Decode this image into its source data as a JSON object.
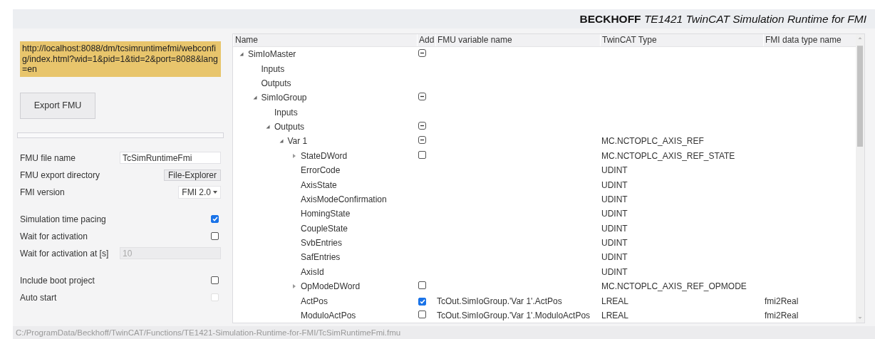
{
  "header": {
    "brand": "BECKHOFF",
    "title": "TE1421 TwinCAT Simulation Runtime for FMI"
  },
  "settings": {
    "url": "http://localhost:8088/dm/tcsimruntimefmi/webconfig/index.html?wid=1&pid=1&tid=2&port=8088&lang=en",
    "export_button": "Export FMU",
    "progress": {
      "level": 0
    },
    "groups": [
      {
        "items": [
          {
            "kind": "text",
            "label": "FMU file name",
            "value": "TcSimRuntimeFmi"
          },
          {
            "kind": "button",
            "label": "FMU export directory",
            "button": "File-Explorer"
          },
          {
            "kind": "select",
            "label": "FMI version",
            "value": "FMI 2.0"
          }
        ]
      },
      {
        "items": [
          {
            "kind": "checkbox",
            "label": "Simulation time pacing",
            "checked": true,
            "disabled": false
          },
          {
            "kind": "checkbox",
            "label": "Wait for activation",
            "checked": false,
            "disabled": false
          },
          {
            "kind": "text",
            "label": "Wait for activation at [s]",
            "value": "10",
            "disabled": true
          }
        ]
      },
      {
        "items": [
          {
            "kind": "checkbox",
            "label": "Include boot project",
            "checked": false,
            "disabled": false
          },
          {
            "kind": "checkbox",
            "label": "Auto start",
            "checked": false,
            "disabled": true
          }
        ]
      }
    ]
  },
  "table": {
    "columns": [
      "Name",
      "Add",
      "FMU variable name",
      "TwinCAT Type",
      "FMI data type name"
    ],
    "rows": [
      {
        "name": "SimIoMaster",
        "expanded": true,
        "mixed": true,
        "children": [
          {
            "name": "Inputs"
          },
          {
            "name": "Outputs"
          },
          {
            "name": "SimIoGroup",
            "expanded": true,
            "mixed": true,
            "children": [
              {
                "name": "Inputs"
              },
              {
                "name": "Outputs",
                "expanded": true,
                "mixed": true,
                "children": [
                  {
                    "name": "Var 1",
                    "expanded": true,
                    "mixed": true,
                    "twincat_type": "MC.NCTOPLC_AXIS_REF",
                    "children": [
                      {
                        "name": "StateDWord",
                        "expanded": false,
                        "checked": false,
                        "twincat_type": "MC.NCTOPLC_AXIS_REF_STATE"
                      },
                      {
                        "name": "ErrorCode",
                        "twincat_type": "UDINT"
                      },
                      {
                        "name": "AxisState",
                        "twincat_type": "UDINT"
                      },
                      {
                        "name": "AxisModeConfirmation",
                        "twincat_type": "UDINT"
                      },
                      {
                        "name": "HomingState",
                        "twincat_type": "UDINT"
                      },
                      {
                        "name": "CoupleState",
                        "twincat_type": "UDINT"
                      },
                      {
                        "name": "SvbEntries",
                        "twincat_type": "UDINT"
                      },
                      {
                        "name": "SafEntries",
                        "twincat_type": "UDINT"
                      },
                      {
                        "name": "AxisId",
                        "twincat_type": "UDINT"
                      },
                      {
                        "name": "OpModeDWord",
                        "expanded": false,
                        "checked": false,
                        "twincat_type": "MC.NCTOPLC_AXIS_REF_OPMODE"
                      },
                      {
                        "name": "ActPos",
                        "checked": true,
                        "fmu_variable": "TcOut.SimIoGroup.'Var 1'.ActPos",
                        "twincat_type": "LREAL",
                        "fmi_type": "fmi2Real"
                      },
                      {
                        "name": "ModuloActPos",
                        "checked": false,
                        "fmu_variable": "TcOut.SimIoGroup.'Var 1'.ModuloActPos",
                        "twincat_type": "LREAL",
                        "fmi_type": "fmi2Real"
                      }
                    ]
                  }
                ]
              }
            ]
          }
        ]
      }
    ]
  },
  "status_bar": {
    "path": "C:/ProgramData/Beckhoff/TwinCAT/Functions/TE1421-Simulation-Runtime-for-FMI/TcSimRuntimeFmi.fmu"
  }
}
